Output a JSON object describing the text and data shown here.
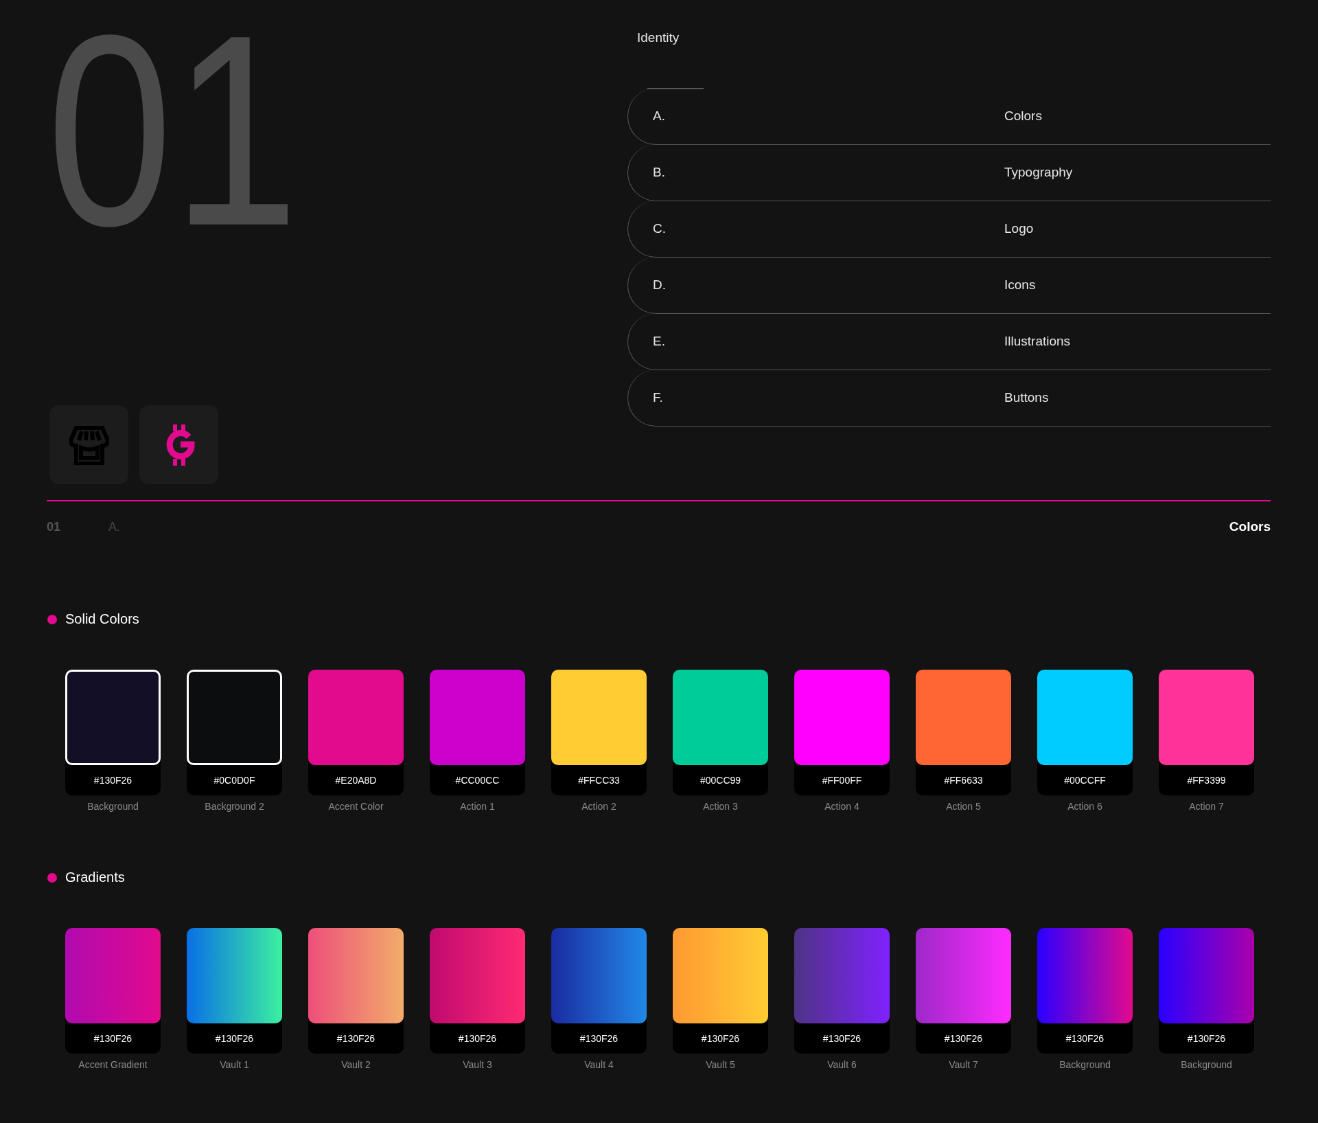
{
  "section_number": "01",
  "identity": {
    "title": "Identity",
    "items": [
      {
        "letter": "A.",
        "label": "Colors"
      },
      {
        "letter": "B.",
        "label": "Typography"
      },
      {
        "letter": "C.",
        "label": "Logo"
      },
      {
        "letter": "D.",
        "label": "Icons"
      },
      {
        "letter": "E.",
        "label": "Illustrations"
      },
      {
        "letter": "F.",
        "label": "Buttons"
      }
    ]
  },
  "meta": {
    "number": "01",
    "letter": "A.",
    "title": "Colors"
  },
  "solid": {
    "title": "Solid Colors",
    "swatches": [
      {
        "hex": "#130F26",
        "name": "Background",
        "color": "#130f26",
        "outlined": true
      },
      {
        "hex": "#0C0D0F",
        "name": "Background 2",
        "color": "#0c0d0f",
        "outlined": true
      },
      {
        "hex": "#E20A8D",
        "name": "Accent Color",
        "color": "#e20a8d",
        "outlined": false
      },
      {
        "hex": "#CC00CC",
        "name": "Action 1",
        "color": "#cc00cc",
        "outlined": false
      },
      {
        "hex": "#FFCC33",
        "name": "Action 2",
        "color": "#ffcc33",
        "outlined": false
      },
      {
        "hex": "#00CC99",
        "name": "Action 3",
        "color": "#00cc99",
        "outlined": false
      },
      {
        "hex": "#FF00FF",
        "name": "Action 4",
        "color": "#ff00ff",
        "outlined": false
      },
      {
        "hex": "#FF6633",
        "name": "Action 5",
        "color": "#ff6633",
        "outlined": false
      },
      {
        "hex": "#00CCFF",
        "name": "Action 6",
        "color": "#00ccff",
        "outlined": false
      },
      {
        "hex": "#FF3399",
        "name": "Action 7",
        "color": "#ff3399",
        "outlined": false
      }
    ]
  },
  "gradients": {
    "title": "Gradients",
    "swatches": [
      {
        "hex": "#130F26",
        "name": "Accent Gradient",
        "stops": [
          {
            "color": "#b00ab0"
          },
          {
            "color": "#e20a8d"
          }
        ]
      },
      {
        "hex": "#130F26",
        "name": "Vault 1",
        "stops": [
          {
            "color": "#0a6fe6"
          },
          {
            "color": "#3cf0a0"
          }
        ]
      },
      {
        "hex": "#130F26",
        "name": "Vault 2",
        "stops": [
          {
            "color": "#ee4f7a"
          },
          {
            "color": "#f2ac6a"
          }
        ]
      },
      {
        "hex": "#130F26",
        "name": "Vault 3",
        "stops": [
          {
            "color": "#c00a6e"
          },
          {
            "color": "#ff2a73"
          }
        ]
      },
      {
        "hex": "#130F26",
        "name": "Vault 4",
        "stops": [
          {
            "color": "#1a2ba0"
          },
          {
            "color": "#2188e8"
          }
        ]
      },
      {
        "hex": "#130F26",
        "name": "Vault 5",
        "stops": [
          {
            "color": "#ff9933"
          },
          {
            "color": "#ffcc33"
          }
        ]
      },
      {
        "hex": "#130F26",
        "name": "Vault 6",
        "stops": [
          {
            "color": "#4f3385"
          },
          {
            "color": "#7f22ff"
          }
        ]
      },
      {
        "hex": "#130F26",
        "name": "Vault 7",
        "stops": [
          {
            "color": "#9e28c8"
          },
          {
            "color": "#ff2bff"
          }
        ]
      },
      {
        "hex": "#130F26",
        "name": "Background",
        "stops": [
          {
            "color": "#2a00ff"
          },
          {
            "color": "#e20a8d"
          }
        ]
      },
      {
        "hex": "#130F26",
        "name": "Background",
        "stops": [
          {
            "color": "#2a00ff"
          },
          {
            "color": "#aa00aa"
          }
        ]
      }
    ]
  }
}
